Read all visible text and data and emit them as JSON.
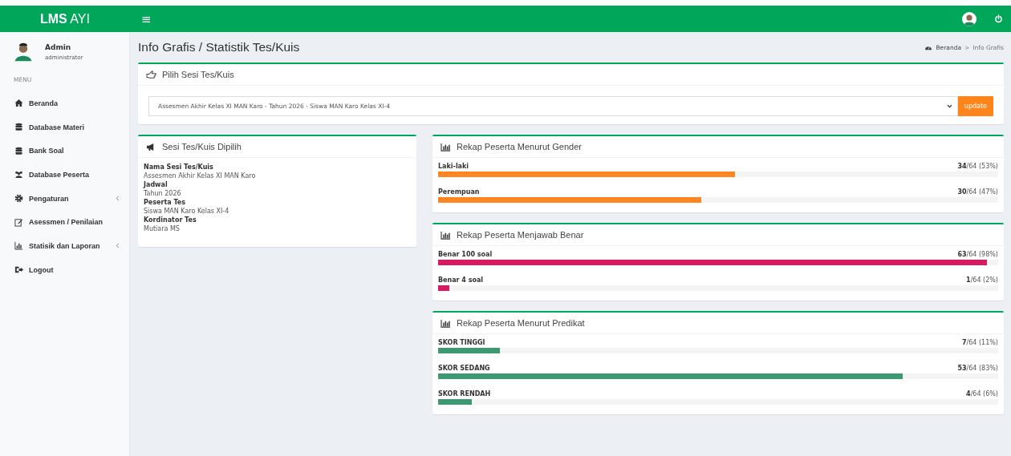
{
  "topbar": {
    "brand": "**LMS** AYI",
    "menu_glyph": "≡"
  },
  "user": {
    "name": "Admin",
    "role": "administrator"
  },
  "sidebar": {
    "heading": "MENU",
    "items": [
      {
        "label": "Beranda",
        "has_submenu": false
      },
      {
        "label": "Database Materi",
        "has_submenu": false
      },
      {
        "label": "Bank Soal",
        "has_submenu": false
      },
      {
        "label": "Database Peserta",
        "has_submenu": false
      },
      {
        "label": "Pengaturan",
        "has_submenu": true
      },
      {
        "label": "Asessmen / Penilaian",
        "has_submenu": false
      },
      {
        "label": "Statisik dan Laporan",
        "has_submenu": true
      },
      {
        "label": "Logout",
        "has_submenu": false
      }
    ]
  },
  "page_title": "Info Grafis / Statistik Tes/Kuis",
  "breadcrumb": {
    "items": [
      "Beranda",
      "Info Grafis"
    ],
    "separator": ">"
  },
  "session_picker": {
    "title": "Pilih Sesi Tes/Kuis",
    "value": "Assesmen Akhir Kelas XI MAN Karo - Tahun 2026 - Siswa MAN Karo Kelas XI-4",
    "button": "update"
  },
  "session_info": {
    "title": "Sesi Tes/Kuis Dipilih",
    "fields": [
      {
        "label": "Nama Sesi Tes/Kuis",
        "value": "Assesmen Akhir Kelas XI MAN Karo"
      },
      {
        "label": "Jadwal",
        "value": "Tahun 2026"
      },
      {
        "label": "Peserta Tes",
        "value": "Siswa MAN Karo Kelas XI-4"
      },
      {
        "label": "Kordinator Tes",
        "value": "Mutiara MS"
      }
    ]
  },
  "panels": [
    {
      "title": "Rekap Peserta Menurut Gender",
      "color": "#fd8622",
      "rows": [
        {
          "label": "Laki-laki",
          "count": "**34**/64 (53%)",
          "level": 0.53
        },
        {
          "label": "Perempuan",
          "count": "**30**/64 (47%)",
          "level": 0.47
        }
      ]
    },
    {
      "title": "Rekap Peserta Menjawab Benar",
      "color": "#d81b60",
      "rows": [
        {
          "label": "Benar 100 soal",
          "count": "**63**/64 (98%)",
          "level": 0.98
        },
        {
          "label": "Benar 4 soal",
          "count": "**1**/64 (2%)",
          "level": 0.02
        }
      ]
    },
    {
      "title": "Rekap Peserta Menurut Predikat",
      "color": "#3d9970",
      "rows": [
        {
          "label": "SKOR TINGGI",
          "count": "**7**/64 (11%)",
          "level": 0.11
        },
        {
          "label": "SKOR SEDANG",
          "count": "**53**/64 (83%)",
          "level": 0.83
        },
        {
          "label": "SKOR RENDAH",
          "count": "**4**/64 (6%)",
          "level": 0.06
        }
      ]
    }
  ]
}
